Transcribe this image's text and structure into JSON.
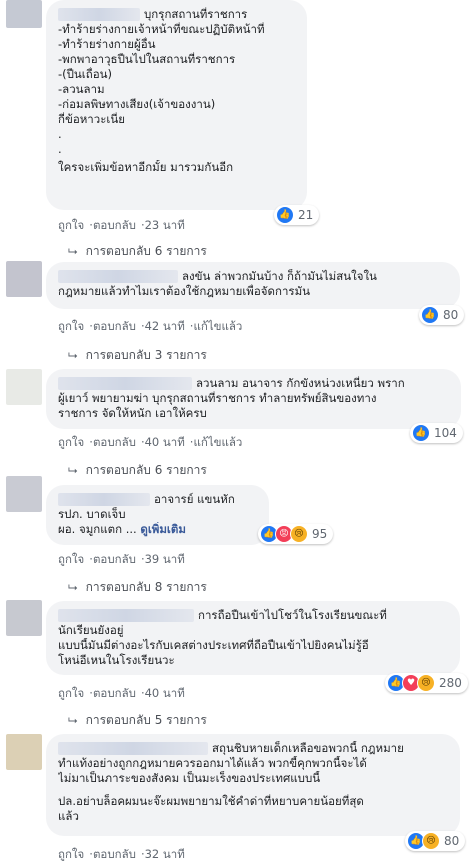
{
  "colors": {
    "link": "#385898",
    "bubble": "#f2f3f5",
    "meta": "#606770",
    "like": "#2078f4"
  },
  "comments": [
    {
      "lines": [
        "บุกรุกสถานที่ราชการ",
        "-ทำร้ายร่างกายเจ้าหน้าที่ขณะปฏิบัติหน้าที่",
        "-ทำร้ายร่างกายผู้อื่น",
        "-พกพาอาวุธปืนไปในสถานที่ราชการ",
        "-(ปืนเถื่อน)",
        "-ลวนลาม",
        "-ก่อมลพิษทางเสียง(เจ้าของงาน)",
        "กี่ข้อหาวะเนี่ย",
        ".",
        ".",
        "ใครจะเพิ่มข้อหาอีกมั้ย มารวมกันอีก"
      ],
      "like": "ถูกใจ",
      "reply": "ตอบกลับ",
      "time": "23 นาที",
      "reaction_count": "21",
      "replies_label": "การตอบกลับ 6 รายการ"
    },
    {
      "lines": [
        "ลงขัน ล่าพวกมันบ้าง ก็ถ้ามันไม่สนใจใน",
        "กฎหมายแล้วทำไมเราต้องใช้กฎหมายเพื่อจัดการมัน"
      ],
      "like": "ถูกใจ",
      "reply": "ตอบกลับ",
      "time": "42 นาที",
      "edited": "แก้ไขแล้ว",
      "reaction_count": "80",
      "replies_label": "การตอบกลับ 3 รายการ"
    },
    {
      "lines": [
        "ลวนลาม อนาจาร กักขังหน่วงเหนี่ยว พราก",
        "ผู้เยาว์ พยายามฆ่า บุกรุกสถานที่ราชการ ทำลายทรัพย์สินของทาง",
        "ราชการ จัดให้หนัก เอาให้ครบ"
      ],
      "like": "ถูกใจ",
      "reply": "ตอบกลับ",
      "time": "40 นาที",
      "edited": "แก้ไขแล้ว",
      "reaction_count": "104",
      "replies_label": "การตอบกลับ 6 รายการ"
    },
    {
      "lines": [
        "อาจารย์ แขนหัก",
        "รปภ. บาดเจ็บ",
        "ผอ. จมูกแตก ..."
      ],
      "see_more": "ดูเพิ่มเติม",
      "like": "ถูกใจ",
      "reply": "ตอบกลับ",
      "time": "39 นาที",
      "reaction_count": "95",
      "replies_label": "การตอบกลับ 8 รายการ"
    },
    {
      "lines": [
        "การถือปืนเข้าไปโชว์ในโรงเรียนขณะที่",
        "นักเรียนยังอยู่",
        "แบบนี้มันมีต่างอะไรกับเคสต่างประเทศที่ถือปืนเข้าไปยิงคนไม่รู้อี",
        "โหน่อีเหนในโรงเรียนวะ"
      ],
      "like": "ถูกใจ",
      "reply": "ตอบกลับ",
      "time": "40 นาที",
      "reaction_count": "280",
      "replies_label": "การตอบกลับ 5 รายการ"
    },
    {
      "lines": [
        "สถุนชิบหายเด็กเหลือขอพวกนี้ กฎหมาย",
        "ทำแท้งอย่างถูกกฎหมายควรออกมาได้แล้ว พวกขี้คุกพวกนี้จะได้",
        "ไม่มาเป็นภาระของสังคม เป็นมะเร็งของประเทศแบบนี้",
        "",
        "ปล.อย่าบล็อคผมนะจ๊ะผมพยายามใช้คำด่าที่หยาบคายน้อยที่สุด",
        "แล้ว"
      ],
      "like": "ถูกใจ",
      "reply": "ตอบกลับ",
      "time": "32 นาที",
      "reaction_count": "80"
    }
  ]
}
